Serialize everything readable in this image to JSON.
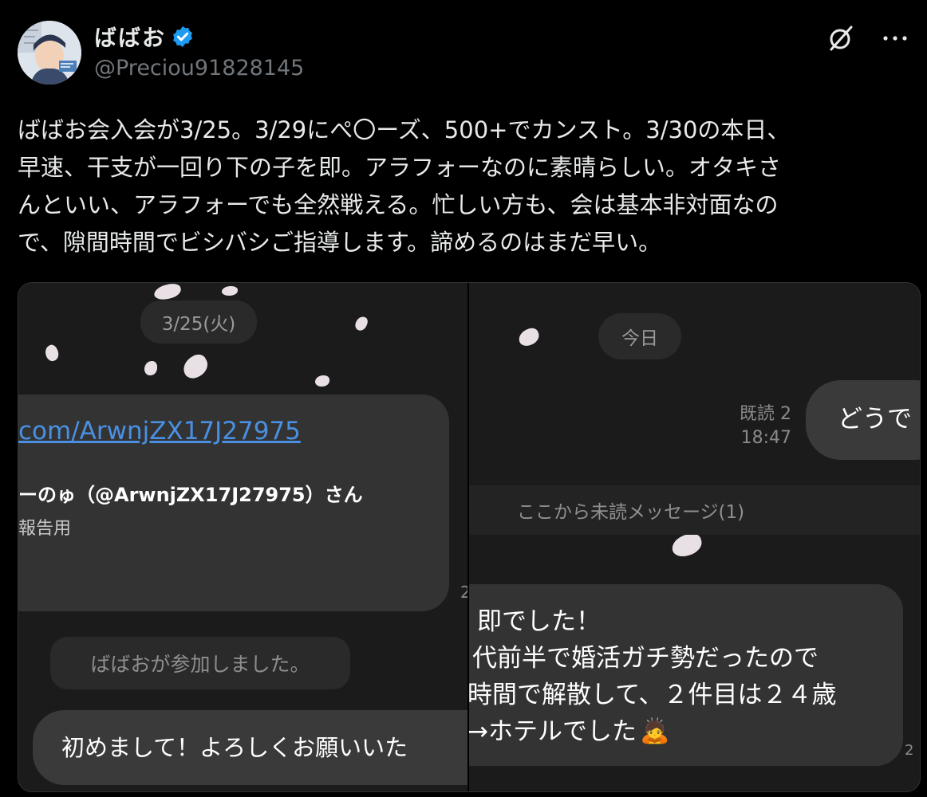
{
  "author": {
    "display_name": "ばばお",
    "handle": "@Preciou91828145"
  },
  "tweet": {
    "lines": [
      "ばばお会入会が3/25。3/29にぺ〇ーズ、500+でカンスト。3/30の本日、",
      "早速、干支が一回り下の子を即。アラフォーなのに素晴らしい。オタキさ",
      "んといい、アラフォーでも全然戦える。忙しい方も、会は基本非対面なの",
      "で、隙間時間でビシバシご指導します。諦めるのはまだ早い。"
    ]
  },
  "left_chat": {
    "date_pill": "3/25(火)",
    "link": "com/ArwnjZX17J27975",
    "card_title": "ーのゅ（@ArwnjZX17J27975）さん",
    "card_sub": "報告用",
    "edge_time": "2",
    "system_message": "ばばおが参加しました。",
    "message": "初めまして！よろしくお願いいた"
  },
  "right_chat": {
    "date_pill": "今日",
    "read_label": "既読 2",
    "time": "18:47",
    "sent_message": "どうで",
    "unread_banner": "ここから未読メッセージ(1)",
    "message_lines": [
      "即でした！",
      "代前半で婚活ガチ勢だったので",
      "時間で解散して、２件目は２４歳",
      "→ホテルでした"
    ],
    "emoji": "🙇",
    "edge_mark": "2"
  },
  "colors": {
    "verified_badge": "#1d9bf0",
    "link": "#4a90e2",
    "background": "#000000",
    "chat_background": "#1b1b1b"
  }
}
